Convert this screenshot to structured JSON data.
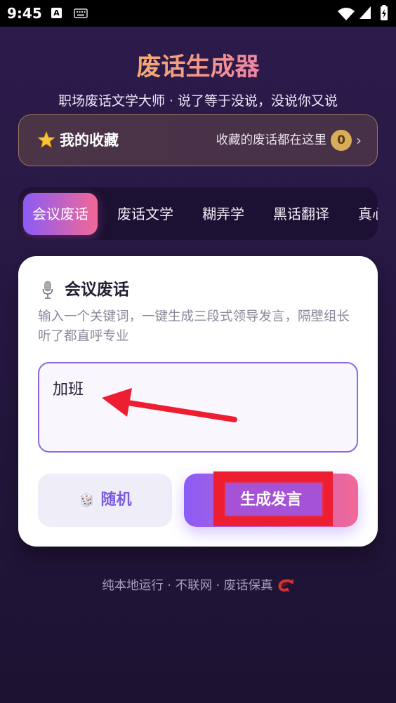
{
  "status_bar": {
    "time": "9:45",
    "notification_letter": "A",
    "left_icons": [
      "a-notification-icon",
      "keyboard-icon"
    ],
    "right_icons": [
      "wifi-icon",
      "signal-icon",
      "battery-charging-icon"
    ]
  },
  "header": {
    "title": "废话生成器",
    "subtitle": "职场废话文学大师 · 说了等于没说，没说你又说"
  },
  "favorites": {
    "icon": "star-icon",
    "label": "我的收藏",
    "hint": "收藏的废话都在这里",
    "count": "0",
    "chevron": "›"
  },
  "tabs": [
    {
      "label": "会议废话",
      "active": true
    },
    {
      "label": "废话文学",
      "active": false
    },
    {
      "label": "糊弄学",
      "active": false
    },
    {
      "label": "黑话翻译",
      "active": false
    },
    {
      "label": "真心",
      "active": false
    }
  ],
  "card": {
    "icon": "microphone-icon",
    "title": "会议废话",
    "description": "输入一个关键词，一键生成三段式领导发言，隔壁组长听了都直呼专业",
    "input": {
      "value": "加班"
    }
  },
  "actions": {
    "random": {
      "icon": "dice-icon",
      "label": "随机"
    },
    "generate": {
      "label": "生成发言"
    }
  },
  "footer": {
    "text": "纯本地运行 · 不联网 · 废话保真",
    "icon": "shrimp-icon"
  },
  "colors": {
    "bg_top": "#2d1b4c",
    "bg_bottom": "#1c1231",
    "title_start": "#f6aa6c",
    "title_end": "#ef86a3",
    "accent_purple": "#8b5cf6",
    "accent_pink": "#f26896",
    "badge_gold": "#d7ad5a",
    "input_border": "#8a6ae4",
    "random_text": "#7b5be2",
    "annotation_red": "#ee1e32"
  }
}
